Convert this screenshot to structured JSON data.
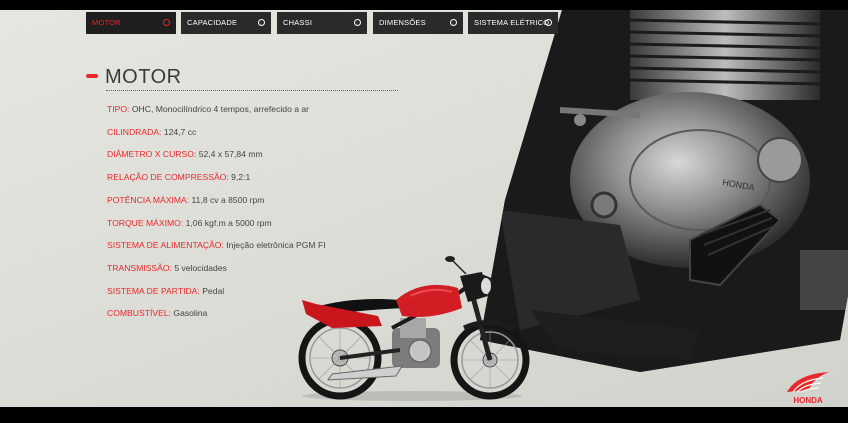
{
  "tabs": [
    {
      "label": "MOTOR",
      "active": true
    },
    {
      "label": "CAPACIDADE",
      "active": false
    },
    {
      "label": "CHASSI",
      "active": false
    },
    {
      "label": "DIMENSÕES",
      "active": false
    },
    {
      "label": "SISTEMA ELÉTRICO",
      "active": false
    }
  ],
  "section": {
    "title": "MOTOR"
  },
  "specs": [
    {
      "label": "TIPO:",
      "value": "OHC, Monocilíndrico 4 tempos, arrefecido a ar"
    },
    {
      "label": "CILINDRADA:",
      "value": "124,7 cc"
    },
    {
      "label": "DIÂMETRO X CURSO:",
      "value": "52,4 x 57,84 mm"
    },
    {
      "label": "RELAÇÃO DE COMPRESSÃO:",
      "value": "9,2:1"
    },
    {
      "label": "POTÊNCIA MÁXIMA:",
      "value": "11,8 cv a 8500 rpm"
    },
    {
      "label": "TORQUE MÁXIMO:",
      "value": "1,06 kgf.m a 5000 rpm"
    },
    {
      "label": "SISTEMA DE ALIMENTAÇÃO:",
      "value": "Injeção eletrônica PGM FI"
    },
    {
      "label": "TRANSMISSÃO:",
      "value": "5 velocidades"
    },
    {
      "label": "SISTEMA DE PARTIDA:",
      "value": "Pedal"
    },
    {
      "label": "COMBUSTÍVEL:",
      "value": "Gasolina"
    }
  ],
  "engine_brand_text": "HONDA",
  "logo": {
    "text": "HONDA"
  },
  "colors": {
    "accent": "#e8282b",
    "tab_bg": "#2a2a2a",
    "background": "#e0e0db"
  }
}
